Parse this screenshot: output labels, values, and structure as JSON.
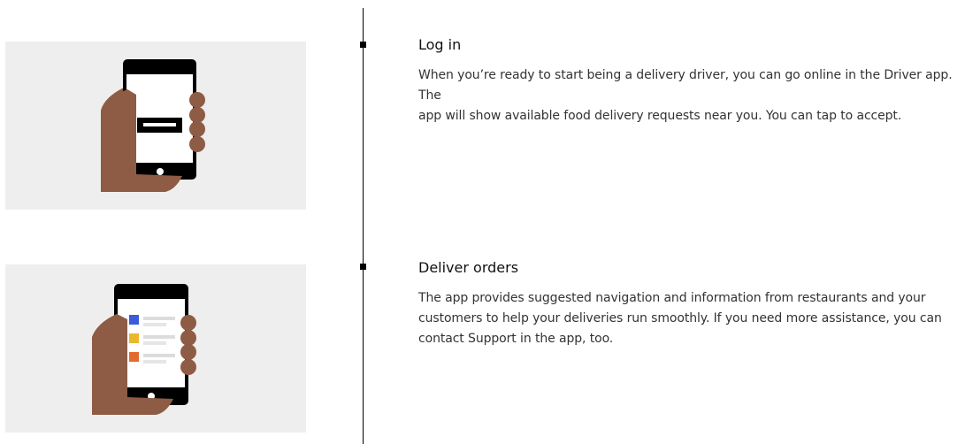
{
  "colors": {
    "illustration_bg": "#eeeeee",
    "skin": "#8e5b44",
    "phone": "#000000",
    "timeline": "#000000"
  },
  "steps": [
    {
      "title": "Log in",
      "body": "When you’re ready to start being a delivery driver, you can go online in the Driver app. The\napp will show available food delivery requests near you. You can tap to accept.",
      "illustration": "hand-holding-phone-login"
    },
    {
      "title": "Deliver orders",
      "body": "The app provides suggested navigation and information from restaurants and your\ncustomers to help your deliveries run smoothly. If you need more assistance, you can\ncontact Support in the app, too.",
      "illustration": "hand-holding-phone-orders"
    }
  ]
}
